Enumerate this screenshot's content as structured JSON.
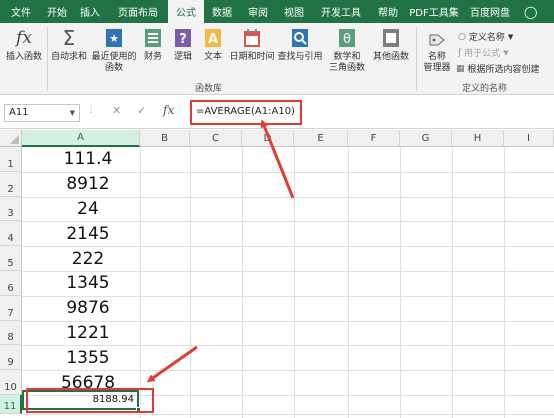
{
  "tabs": [
    "文件",
    "开始",
    "插入",
    "页面布局",
    "公式",
    "数据",
    "审阅",
    "视图",
    "开发工具",
    "帮助",
    "PDF工具集",
    "百度网盘"
  ],
  "active_tab": "公式",
  "ribbon": {
    "insert_function": "插入函数",
    "autosum": "自动求和",
    "recent_line1": "最近使用的",
    "recent_line2": "函数",
    "financial": "财务",
    "logical": "逻辑",
    "text": "文本",
    "datetime": "日期和时间",
    "lookup": "查找与引用",
    "math_line1": "数学和",
    "math_line2": "三角函数",
    "more": "其他函数",
    "group_library": "函数库",
    "name_manager_line1": "名称",
    "name_manager_line2": "管理器",
    "define_name": "定义名称",
    "use_in_formula": "用于公式",
    "create_from_selection": "根据所选内容创建",
    "group_names": "定义的名称"
  },
  "formula_bar": {
    "name_box": "A11",
    "fx": "fx",
    "formula": "=AVERAGE(A1:A10)"
  },
  "columns": [
    "A",
    "B",
    "C",
    "D",
    "E",
    "F",
    "G",
    "H",
    "I"
  ],
  "rows": [
    "1",
    "2",
    "3",
    "4",
    "5",
    "6",
    "7",
    "8",
    "9",
    "10",
    "11"
  ],
  "cells_A": [
    "111.4",
    "8912",
    "24",
    "2145",
    "222",
    "1345",
    "9876",
    "1221",
    "1355",
    "56678"
  ],
  "active_cell_value": "8188.94",
  "colors": {
    "excel_green": "#217346",
    "highlight_red": "#e03c31"
  }
}
